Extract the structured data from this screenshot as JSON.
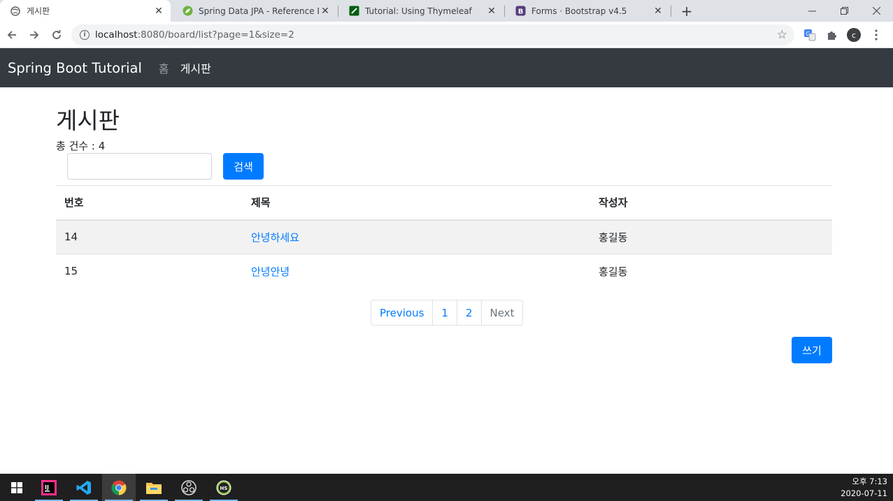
{
  "browser": {
    "tabs": [
      {
        "title": "게시판",
        "active": true
      },
      {
        "title": "Spring Data JPA - Reference Dc",
        "active": false
      },
      {
        "title": "Tutorial: Using Thymeleaf",
        "active": false
      },
      {
        "title": "Forms · Bootstrap v4.5",
        "active": false
      }
    ],
    "url_host": "localhost",
    "url_rest": ":8080/board/list?page=1&size=2",
    "profile_initial": "c"
  },
  "navbar": {
    "brand": "Spring Boot Tutorial",
    "links": [
      "홈",
      "게시판"
    ]
  },
  "page": {
    "title": "게시판",
    "total_label": "총 건수 : 4",
    "search_value": "",
    "search_button": "검색",
    "write_button": "쓰기"
  },
  "table": {
    "headers": [
      "번호",
      "제목",
      "작성자"
    ],
    "rows": [
      {
        "id": "14",
        "title": "안녕하세요",
        "author": "홍길동"
      },
      {
        "id": "15",
        "title": "안녕안녕",
        "author": "홍길동"
      }
    ]
  },
  "pagination": [
    "Previous",
    "1",
    "2",
    "Next"
  ],
  "taskbar": {
    "time": "오후 7:13",
    "date": "2020-07-11"
  },
  "colors": {
    "primary": "#007bff",
    "navbar_bg": "#343a40"
  }
}
